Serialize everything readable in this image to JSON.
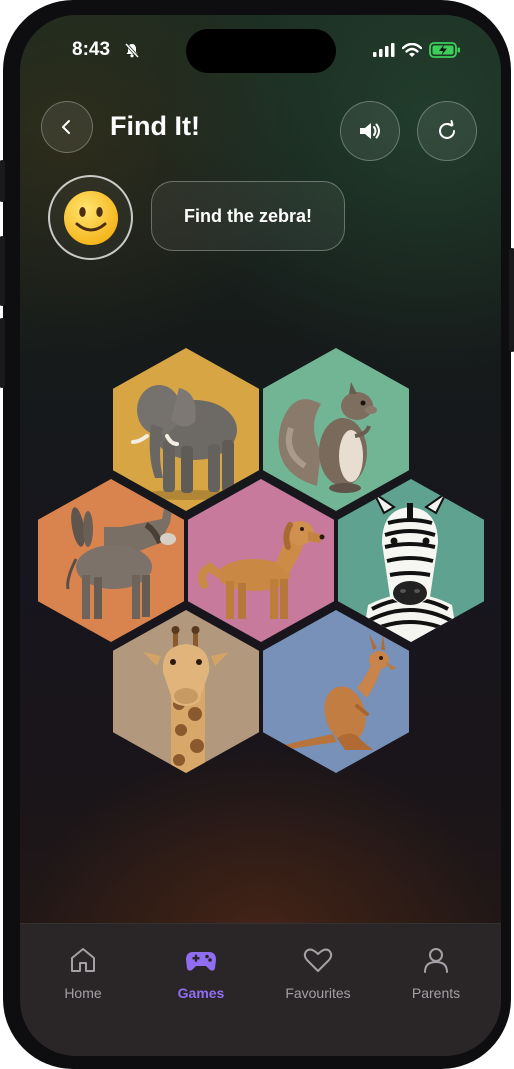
{
  "status": {
    "time": "8:43"
  },
  "header": {
    "title": "Find It!"
  },
  "prompt": {
    "text": "Find the zebra!"
  },
  "tiles": [
    {
      "animal": "elephant",
      "color": "#d8a544"
    },
    {
      "animal": "squirrel",
      "color": "#72b595"
    },
    {
      "animal": "donkey",
      "color": "#d9834f"
    },
    {
      "animal": "dog",
      "color": "#c77a9c"
    },
    {
      "animal": "zebra",
      "color": "#5fa28f"
    },
    {
      "animal": "giraffe",
      "color": "#b2987c"
    },
    {
      "animal": "kangaroo",
      "color": "#7791b9"
    }
  ],
  "tabs": [
    {
      "label": "Home",
      "icon": "home-icon"
    },
    {
      "label": "Games",
      "icon": "gamepad-icon",
      "active": true
    },
    {
      "label": "Favourites",
      "icon": "heart-icon"
    },
    {
      "label": "Parents",
      "icon": "person-icon"
    }
  ],
  "colors": {
    "accent": "#8f6ef2"
  }
}
